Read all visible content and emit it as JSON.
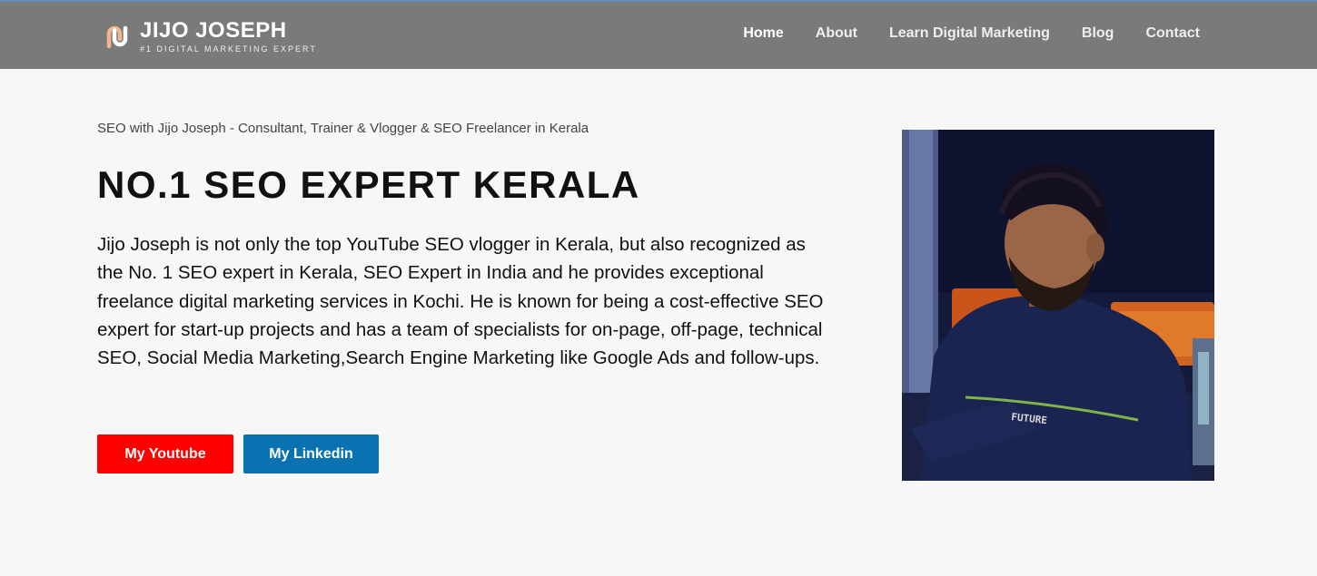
{
  "header": {
    "brand_name": "JIJO JOSEPH",
    "brand_tagline": "#1 DIGITAL MARKETING EXPERT",
    "nav": [
      {
        "label": "Home",
        "active": true
      },
      {
        "label": "About"
      },
      {
        "label": "Learn Digital Marketing"
      },
      {
        "label": "Blog"
      },
      {
        "label": "Contact"
      }
    ]
  },
  "hero": {
    "subtitle": "SEO with Jijo Joseph - Consultant, Trainer & Vlogger & SEO Freelancer in Kerala",
    "title": "NO.1 SEO EXPERT KERALA",
    "description": "Jijo Joseph is not only the top YouTube SEO vlogger in Kerala, but also recognized as the No. 1 SEO expert in Kerala, SEO Expert in India and he provides exceptional freelance digital marketing services in Kochi. He is known for being a cost-effective SEO expert for start-up projects and has a team of specialists for on-page, off-page, technical SEO, Social Media Marketing,Search Engine Marketing like Google Ads and follow-ups.",
    "buttons": {
      "youtube": "My Youtube",
      "linkedin": "My Linkedin"
    },
    "photo_shirt_text": "FUTURE"
  },
  "colors": {
    "header_bg": "#7a7a7a",
    "youtube": "#ff0000",
    "linkedin": "#0a72b1",
    "logo_accent": "#f4b48f"
  }
}
